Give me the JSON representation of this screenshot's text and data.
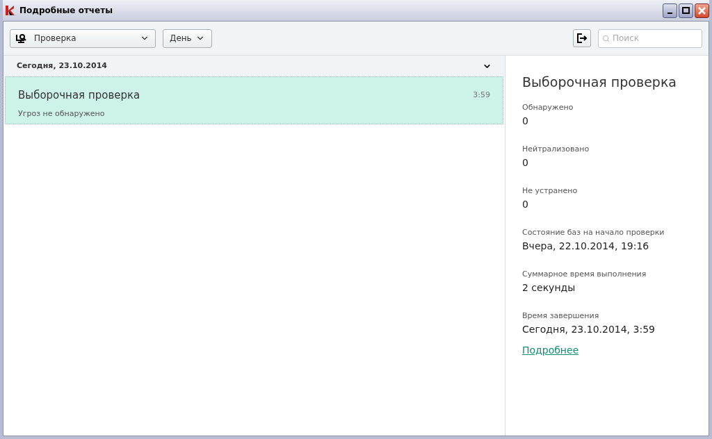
{
  "window": {
    "title": "Подробные отчеты"
  },
  "toolbar": {
    "type_select": "Проверка",
    "period_select": "День",
    "search": {
      "placeholder": "Поиск"
    }
  },
  "groups": [
    {
      "title": "Сегодня, 23.10.2014",
      "expanded": true,
      "items": [
        {
          "title": "Выборочная проверка",
          "subtitle": "Угроз не обнаружено",
          "time": "3:59",
          "selected": true
        }
      ]
    }
  ],
  "details": {
    "title": "Выборочная проверка",
    "fields": [
      {
        "label": "Обнаружено",
        "value": "0"
      },
      {
        "label": "Нейтрализовано",
        "value": "0"
      },
      {
        "label": "Не устранено",
        "value": "0"
      },
      {
        "label": "Состояние баз на начало проверки",
        "value": "Вчера, 22.10.2014, 19:16"
      },
      {
        "label": "Суммарное время выполнения",
        "value": "2 секунды"
      },
      {
        "label": "Время завершения",
        "value": "Сегодня, 23.10.2014, 3:59"
      }
    ],
    "link": "Подробнее"
  }
}
